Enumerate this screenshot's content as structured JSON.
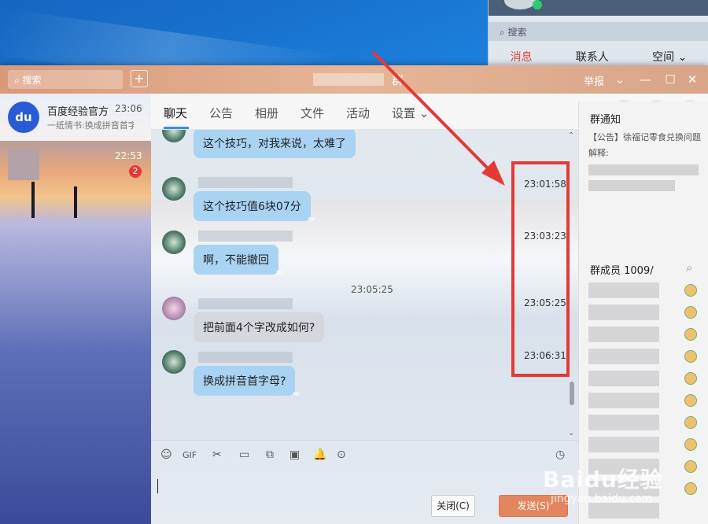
{
  "desktop": {
    "bg_search_label": "搜索",
    "bg_tabs": [
      "消息",
      "联系人",
      "空间 ⌄"
    ]
  },
  "titlebar": {
    "search_placeholder": "搜索",
    "plus": "+",
    "title": "群",
    "report": "举报",
    "dropdown": "⌄",
    "minimize": "—",
    "maximize": "☐",
    "close": "✕"
  },
  "sessions": [
    {
      "avatar": "du",
      "name": "百度经验官方",
      "message": "一纸情书:换成拼音首字母?",
      "time": "23:06"
    },
    {
      "avatar": "",
      "name": "",
      "message": "",
      "time": "22:53",
      "badge": "2"
    }
  ],
  "tabs": [
    "聊天",
    "公告",
    "相册",
    "文件",
    "活动",
    "设置 ⌄"
  ],
  "round_buttons": [
    "☎",
    "✚",
    "⋯"
  ],
  "messages": [
    {
      "type": "in",
      "text": "这个技巧，对我来说，太难了"
    },
    {
      "type": "in",
      "text": "这个技巧值6块07分"
    },
    {
      "type": "in",
      "text": "啊，不能撤回"
    },
    {
      "type": "time",
      "text": "23:05:25"
    },
    {
      "type": "in",
      "text": "把前面4个字改成如何?"
    },
    {
      "type": "in",
      "text": "换成拼音首字母?"
    }
  ],
  "highlight_times": [
    "23:01:58",
    "23:03:23",
    "23:05:25",
    "23:06:31"
  ],
  "toolbar": [
    "☺",
    "GIF",
    "✂",
    "▭",
    "⧉",
    "▣",
    "🔔",
    "⊙",
    "◷"
  ],
  "buttons": {
    "close": "关闭(C)",
    "send": "发送(S)"
  },
  "right_panel": {
    "notice_title": "群通知",
    "notice_text": "【公告】徐福记零食兑换问题解释:",
    "members_title": "群成员 1009/",
    "search_icon": "⌕"
  },
  "watermark": {
    "brand": "Baidu经验",
    "url": "jingyan.baidu.com"
  }
}
